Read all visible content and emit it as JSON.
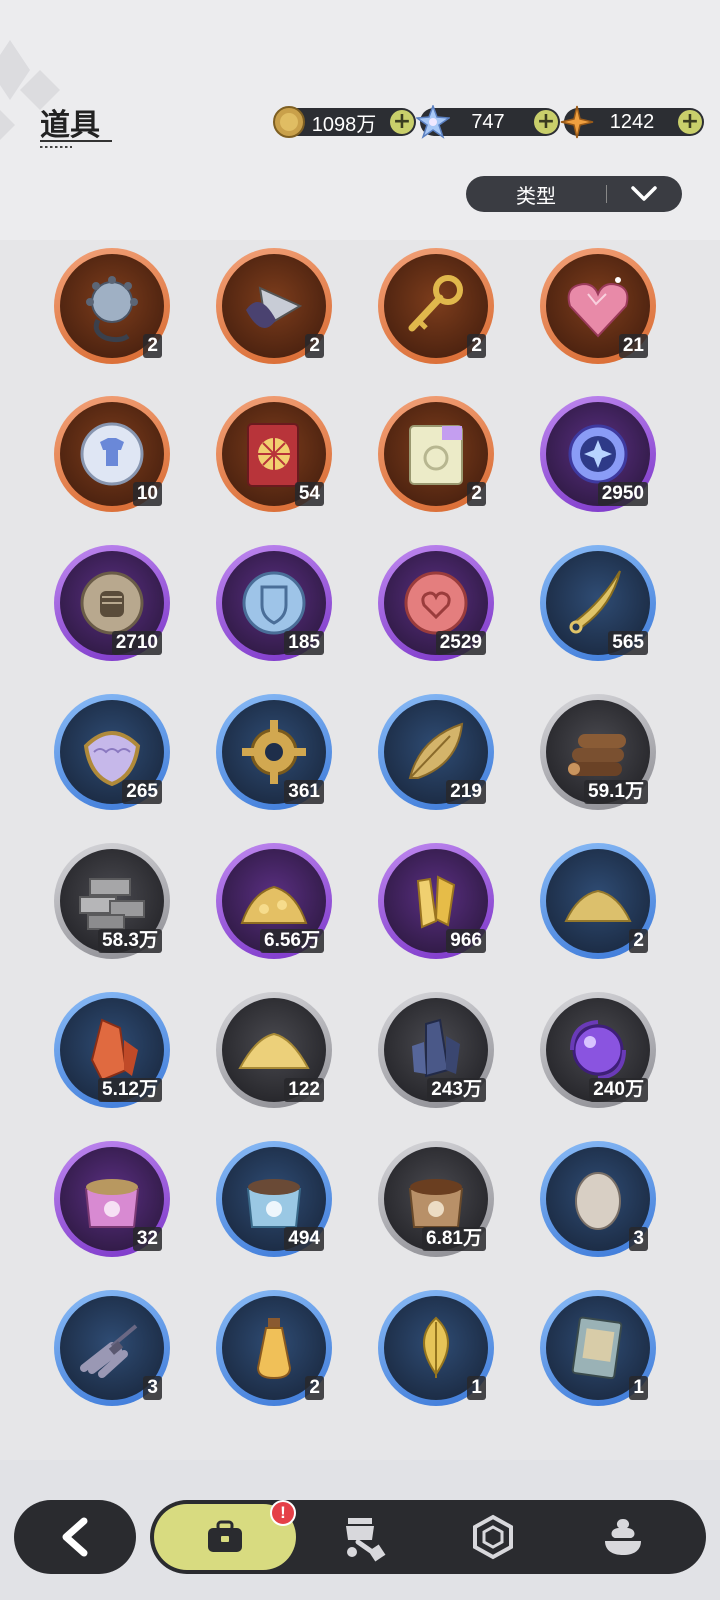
{
  "header": {
    "title": "道具",
    "filter_label": "类型"
  },
  "currencies": [
    {
      "name": "gold-coin",
      "value": "1098万",
      "add": "+"
    },
    {
      "name": "star-crystal",
      "value": "747",
      "add": "+"
    },
    {
      "name": "orange-star",
      "value": "1242",
      "add": "+"
    }
  ],
  "items": [
    {
      "icon": "spiked-ball-chain-icon",
      "rarity": "orange",
      "count": "2"
    },
    {
      "icon": "drill-icon",
      "rarity": "orange",
      "count": "2"
    },
    {
      "icon": "golden-key-icon",
      "rarity": "orange",
      "count": "2"
    },
    {
      "icon": "pink-crystal-heart-icon",
      "rarity": "orange",
      "count": "21"
    },
    {
      "icon": "shirt-token-icon",
      "rarity": "orange",
      "count": "10"
    },
    {
      "icon": "wheel-ticket-icon",
      "rarity": "orange",
      "count": "54"
    },
    {
      "icon": "rainbow-ticket-icon",
      "rarity": "orange",
      "count": "2"
    },
    {
      "icon": "star-orb-icon",
      "rarity": "purple",
      "count": "2950"
    },
    {
      "icon": "fist-token-icon",
      "rarity": "purple",
      "count": "2710"
    },
    {
      "icon": "shield-token-icon",
      "rarity": "purple",
      "count": "185"
    },
    {
      "icon": "heart-token-icon",
      "rarity": "purple",
      "count": "2529"
    },
    {
      "icon": "curved-blade-icon",
      "rarity": "blue",
      "count": "565"
    },
    {
      "icon": "scale-plate-icon",
      "rarity": "blue",
      "count": "265"
    },
    {
      "icon": "gear-icon",
      "rarity": "blue",
      "count": "361"
    },
    {
      "icon": "golden-leaf-icon",
      "rarity": "blue",
      "count": "219"
    },
    {
      "icon": "wood-logs-icon",
      "rarity": "gray",
      "count": "59.1万"
    },
    {
      "icon": "stone-bricks-icon",
      "rarity": "gray",
      "count": "58.3万"
    },
    {
      "icon": "gold-ore-pile-icon",
      "rarity": "purple",
      "count": "6.56万"
    },
    {
      "icon": "gold-crystal-shards-icon",
      "rarity": "purple",
      "count": "966"
    },
    {
      "icon": "gold-dust-pile-icon",
      "rarity": "blue",
      "count": "2"
    },
    {
      "icon": "red-crystal-icon",
      "rarity": "blue",
      "count": "5.12万"
    },
    {
      "icon": "sand-pile-icon",
      "rarity": "gray",
      "count": "122"
    },
    {
      "icon": "dark-crystal-icon",
      "rarity": "gray",
      "count": "243万"
    },
    {
      "icon": "purple-orb-icon",
      "rarity": "gray",
      "count": "240万"
    },
    {
      "icon": "pink-pet-food-bag-icon",
      "rarity": "purple",
      "count": "32"
    },
    {
      "icon": "blue-pet-food-bag-icon",
      "rarity": "blue",
      "count": "494"
    },
    {
      "icon": "brown-pet-food-bag-icon",
      "rarity": "gray",
      "count": "6.81万"
    },
    {
      "icon": "egg-icon",
      "rarity": "blue",
      "count": "3"
    },
    {
      "icon": "herb-bundle-icon",
      "rarity": "blue",
      "count": "3"
    },
    {
      "icon": "potion-bottle-icon",
      "rarity": "blue",
      "count": "2"
    },
    {
      "icon": "yellow-leaf-icon",
      "rarity": "blue",
      "count": "1"
    },
    {
      "icon": "card-book-icon",
      "rarity": "blue",
      "count": "1"
    }
  ],
  "nav": {
    "badge": "!",
    "tabs": [
      "back-arrow-icon",
      "bag-icon",
      "pot-wrench-icon",
      "gem-outline-icon",
      "cream-bowl-icon"
    ]
  }
}
